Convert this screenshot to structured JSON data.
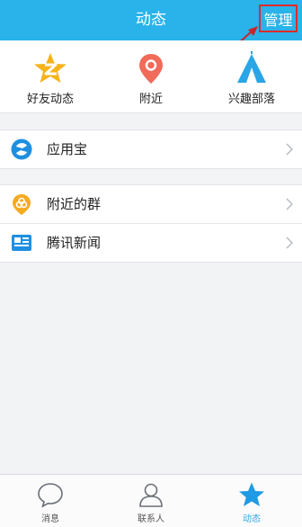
{
  "header": {
    "title": "动态",
    "manage_label": "管理"
  },
  "quick_entries": [
    {
      "label": "好友动态",
      "icon": "qzone-star-icon"
    },
    {
      "label": "附近",
      "icon": "location-pin-icon"
    },
    {
      "label": "兴趣部落",
      "icon": "tent-icon"
    }
  ],
  "groups": [
    {
      "items": [
        {
          "label": "应用宝",
          "icon": "app-store-icon"
        }
      ]
    },
    {
      "items": [
        {
          "label": "附近的群",
          "icon": "nearby-group-icon"
        },
        {
          "label": "腾讯新闻",
          "icon": "news-icon"
        }
      ]
    }
  ],
  "tabs": [
    {
      "label": "消息",
      "icon": "chat-bubble-icon",
      "active": false
    },
    {
      "label": "联系人",
      "icon": "contact-icon",
      "active": false
    },
    {
      "label": "动态",
      "icon": "star-icon",
      "active": true
    }
  ],
  "colors": {
    "header_bg": "#29b3ea",
    "accent": "#29a9e0",
    "annotation": "#e02b2b"
  }
}
